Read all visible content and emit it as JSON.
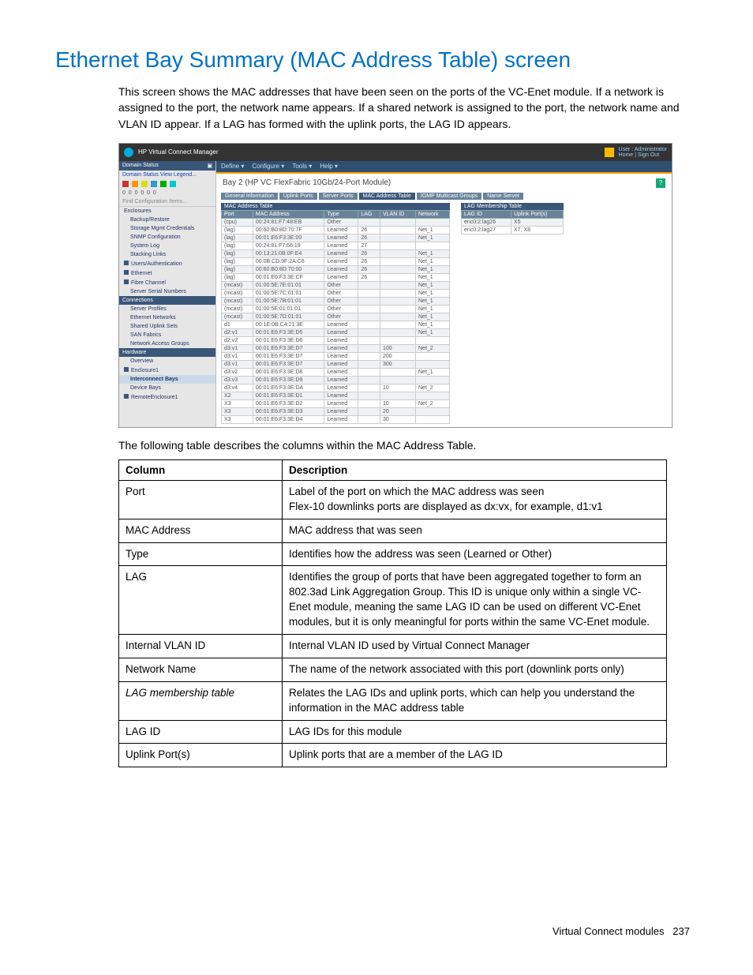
{
  "page": {
    "title": "Ethernet Bay Summary (MAC Address Table) screen",
    "intro": "This screen shows the MAC addresses that have been seen on the ports of the VC-Enet module. If a network is assigned to the port, the network name appears. If a shared network is assigned to the port, the network name and VLAN ID appear. If a LAG has formed with the uplink ports, the LAG ID appears.",
    "between": "The following table describes the columns within the MAC Address Table.",
    "footer_left": "Virtual Connect modules",
    "footer_page": "237"
  },
  "screenshot": {
    "app_title": "HP Virtual Connect Manager",
    "user_label": "User : Administrator",
    "links": "Home | Sign Out",
    "menubar": [
      "Define ▾",
      "Configure ▾",
      "Tools ▾",
      "Help ▾"
    ],
    "module_title": "Bay 2 (HP VC FlexFabric 10Gb/24-Port Module)",
    "tabs": [
      "General Information",
      "Uplink Ports",
      "Server Ports",
      "MAC Address Table",
      "IGMP Multicast Groups",
      "Name Server"
    ],
    "active_tab_index": 3,
    "sidebar": {
      "header": "Domain Status",
      "sub": "Domain Status   View Legend...",
      "find": "Find Configuration Items...",
      "items": [
        {
          "label": "Enclosures",
          "cls": ""
        },
        {
          "label": "Backup/Restore",
          "cls": "ind"
        },
        {
          "label": "Storage Mgmt Credentials",
          "cls": "ind"
        },
        {
          "label": "SNMP Configuration",
          "cls": "ind"
        },
        {
          "label": "System Log",
          "cls": "ind"
        },
        {
          "label": "Stacking Links",
          "cls": "ind"
        },
        {
          "label": "Users/Authentication",
          "cls": "sq"
        },
        {
          "label": "Ethernet",
          "cls": "sq"
        },
        {
          "label": "Fibre Channel",
          "cls": "sq"
        },
        {
          "label": "Server Serial Numbers",
          "cls": "ind"
        }
      ],
      "cat2": "Connections",
      "items2": [
        {
          "label": "Server Profiles",
          "cls": "ind"
        },
        {
          "label": "Ethernet Networks",
          "cls": "ind"
        },
        {
          "label": "Shared Uplink Sets",
          "cls": "ind"
        },
        {
          "label": "SAN Fabrics",
          "cls": "ind"
        },
        {
          "label": "Network Access Groups",
          "cls": "ind"
        }
      ],
      "cat3": "Hardware",
      "items3": [
        {
          "label": "Overview",
          "cls": "ind"
        },
        {
          "label": "Enclosure1",
          "cls": "sq"
        },
        {
          "label": "Interconnect Bays",
          "cls": "ind sel"
        },
        {
          "label": "Device Bays",
          "cls": "ind"
        },
        {
          "label": "RemoteEnclosure1",
          "cls": "sq"
        }
      ]
    },
    "mac_table": {
      "title": "MAC Address Table",
      "headers": [
        "Port",
        "MAC Address",
        "Type",
        "LAG",
        "VLAN ID",
        "Network"
      ],
      "rows": [
        [
          "(cpu)",
          "00:24:81:F7:48:EB",
          "Other",
          "",
          "",
          ""
        ],
        [
          "(lag)",
          "00:60:B0:8D:70:7F",
          "Learned",
          "26",
          "",
          "Net_1"
        ],
        [
          "(lag)",
          "00:01:E6:F3:3E:00",
          "Learned",
          "26",
          "",
          "Net_1"
        ],
        [
          "(lag)",
          "00:24:81:F7:66:19",
          "Learned",
          "27",
          "",
          ""
        ],
        [
          "(lag)",
          "00:13:21:0B:0F:E4",
          "Learned",
          "26",
          "",
          "Net_1"
        ],
        [
          "(lag)",
          "00:0B:CD:9F:2A:C6",
          "Learned",
          "26",
          "",
          "Net_1"
        ],
        [
          "(lag)",
          "00:60:B0:8D:70:00",
          "Learned",
          "26",
          "",
          "Net_1"
        ],
        [
          "(lag)",
          "00:01:E6:F3:3E:CF",
          "Learned",
          "26",
          "",
          "Net_1"
        ],
        [
          "(mcast)",
          "01:00:5E:7E:01:01",
          "Other",
          "",
          "",
          "Net_1"
        ],
        [
          "(mcast)",
          "01:00:5E:7C:01:01",
          "Other",
          "",
          "",
          "Net_1"
        ],
        [
          "(mcast)",
          "01:00:5E:7B:01:01",
          "Other",
          "",
          "",
          "Net_1"
        ],
        [
          "(mcast)",
          "01:00:5E:01:01:01",
          "Other",
          "",
          "",
          "Net_1"
        ],
        [
          "(mcast)",
          "01:00:5E:7D:01:01",
          "Other",
          "",
          "",
          "Net_1"
        ],
        [
          "d1",
          "00:1E:0B:C4:21:3E",
          "Learned",
          "",
          "",
          "Net_1"
        ],
        [
          "d2:v1",
          "00:01:E6:F3:3E:D5",
          "Learned",
          "",
          "",
          "Net_1"
        ],
        [
          "d2:v2",
          "00:01:E6:F3:3E:D6",
          "Learned",
          "",
          "",
          ""
        ],
        [
          "d3:v1",
          "00:01:E6:F3:3E:D7",
          "Learned",
          "",
          "100",
          "Net_2"
        ],
        [
          "d3:v1",
          "00:01:E6:F3:3E:D7",
          "Learned",
          "",
          "200",
          ""
        ],
        [
          "d3:v1",
          "00:01:E6:F3:3E:D7",
          "Learned",
          "",
          "300",
          ""
        ],
        [
          "d3:v2",
          "00:01:E6:F3:3E:D8",
          "Learned",
          "",
          "",
          "Net_1"
        ],
        [
          "d3:v3",
          "00:01:E6:F3:3E:D9",
          "Learned",
          "",
          "",
          ""
        ],
        [
          "d3:v4",
          "00:01:E6:F3:3E:DA",
          "Learned",
          "",
          "10",
          "Net_2"
        ],
        [
          "X2",
          "00:01:E6:F3:3E:D1",
          "Learned",
          "",
          "",
          ""
        ],
        [
          "X3",
          "00:01:E6:F3:3E:D2",
          "Learned",
          "",
          "10",
          "Net_2"
        ],
        [
          "X3",
          "00:01:E6:F3:3E:D3",
          "Learned",
          "",
          "20",
          ""
        ],
        [
          "X3",
          "00:01:E6:F3:3E:D4",
          "Learned",
          "",
          "30",
          ""
        ]
      ]
    },
    "lag_table": {
      "title": "LAG Membership Table",
      "headers": [
        "LAG ID",
        "Uplink Port(s)"
      ],
      "rows": [
        [
          "enc0:2:lag26",
          "X5"
        ],
        [
          "enc0:2:lag27",
          "X7, X8"
        ]
      ]
    }
  },
  "desc_table": {
    "headers": [
      "Column",
      "Description"
    ],
    "rows": [
      {
        "col": "Port",
        "desc": "Label of the port on which the MAC address was seen\nFlex-10 downlinks ports are displayed as dx:vx, for example, d1:v1",
        "italic": false
      },
      {
        "col": "MAC Address",
        "desc": "MAC address that was seen",
        "italic": false
      },
      {
        "col": "Type",
        "desc": "Identifies how the address was seen (Learned or Other)",
        "italic": false
      },
      {
        "col": "LAG",
        "desc": "Identifies the group of ports that have been aggregated together to form an 802.3ad Link Aggregation Group. This ID is unique only within a single VC-Enet module, meaning the same LAG ID can be used on different VC-Enet modules, but it is only meaningful for ports within the same VC-Enet module.",
        "italic": false
      },
      {
        "col": "Internal VLAN ID",
        "desc": "Internal VLAN ID used by Virtual Connect Manager",
        "italic": false
      },
      {
        "col": "Network Name",
        "desc": "The name of the network associated with this port (downlink ports only)",
        "italic": false
      },
      {
        "col": "LAG membership table",
        "desc": "Relates the LAG IDs and uplink ports, which can help you understand the information in the MAC address table",
        "italic": true
      },
      {
        "col": "LAG ID",
        "desc": "LAG IDs for this module",
        "italic": false
      },
      {
        "col": "Uplink Port(s)",
        "desc": "Uplink ports that are a member of the LAG ID",
        "italic": false
      }
    ]
  }
}
